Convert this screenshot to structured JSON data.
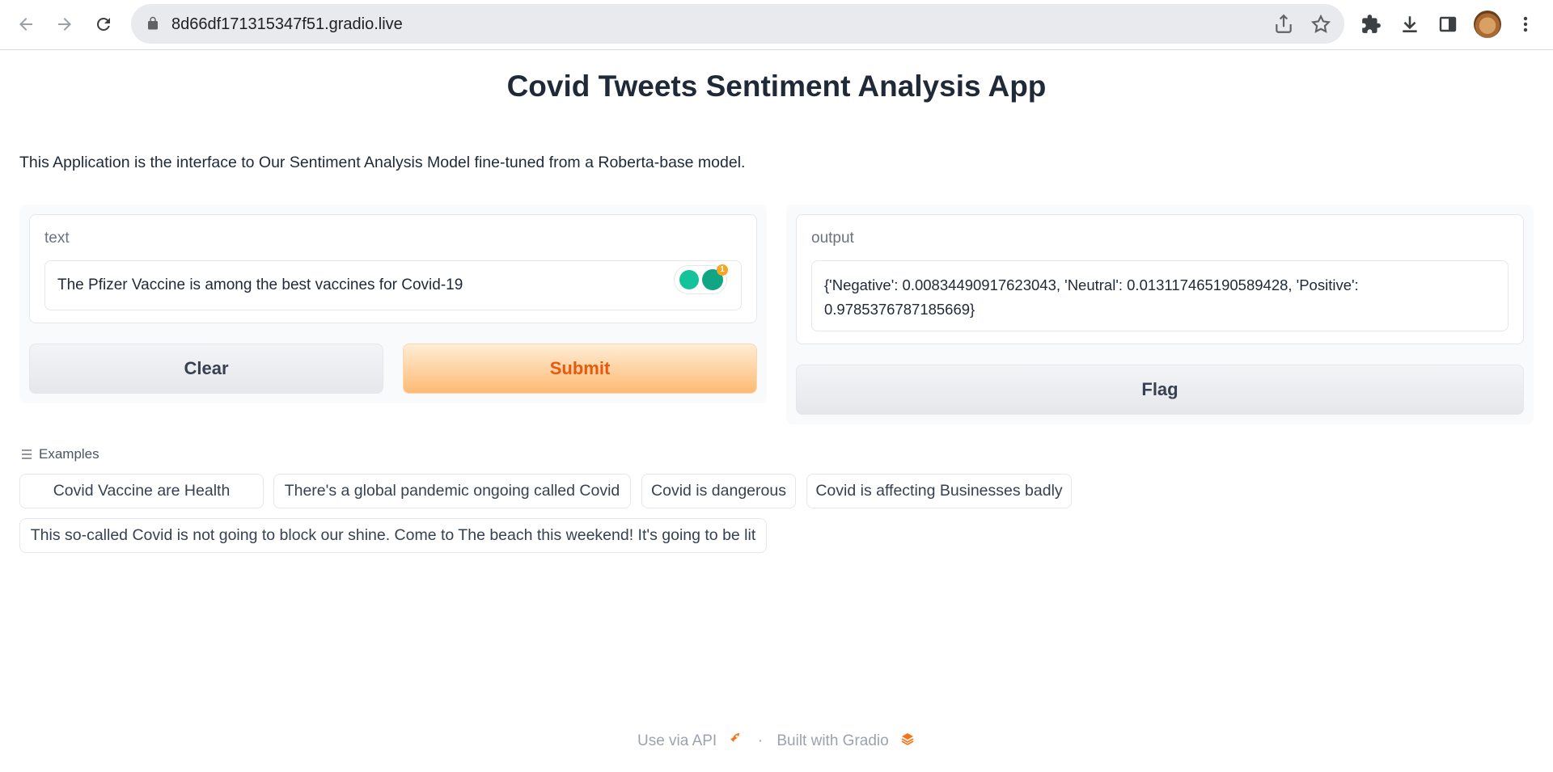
{
  "browser": {
    "url": "8d66df171315347f51.gradio.live"
  },
  "app": {
    "title": "Covid Tweets Sentiment Analysis App",
    "description": "This Application is the interface to Our Sentiment Analysis Model fine-tuned from a Roberta-base model."
  },
  "input": {
    "label": "text",
    "value": "The Pfizer Vaccine is among the best vaccines for Covid-19",
    "grammarly_badge": "1"
  },
  "output": {
    "label": "output",
    "value": "{'Negative': 0.00834490917623043, 'Neutral': 0.013117465190589428, 'Positive': 0.9785376787185669}"
  },
  "buttons": {
    "clear": "Clear",
    "submit": "Submit",
    "flag": "Flag"
  },
  "examples": {
    "label": "Examples",
    "items": [
      "Covid Vaccine are Health",
      "There's a global pandemic ongoing called Covid",
      "Covid is dangerous",
      "Covid is affecting Businesses badly",
      "This so-called Covid is not going to block our shine. Come to The beach this weekend! It's going to be lit"
    ]
  },
  "footer": {
    "api": "Use via API",
    "separator": "·",
    "built": "Built with Gradio"
  },
  "colors": {
    "accent": "#ea580c",
    "primary_button": "#fdba74"
  }
}
